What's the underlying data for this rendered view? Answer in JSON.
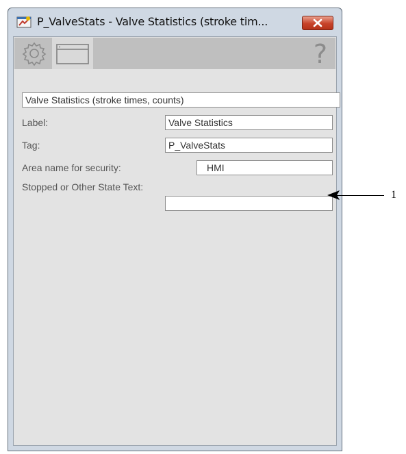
{
  "window": {
    "title": "P_ValveStats - Valve Statistics (stroke tim...",
    "close_icon": "close-icon",
    "app_icon": "faceplate-app-icon"
  },
  "toolbar": {
    "tabs": [
      {
        "icon": "gear-icon",
        "name": "config"
      },
      {
        "icon": "window-icon",
        "name": "display"
      }
    ],
    "help_label": "?"
  },
  "form": {
    "description": "Valve Statistics (stroke times, counts)",
    "label_label": "Label:",
    "label_value": "Valve Statistics",
    "tag_label": "Tag:",
    "tag_value": "P_ValveStats",
    "area_label": "Area name for security:",
    "area_value": "HMI",
    "state_text_label": "Stopped or Other State Text:",
    "state_text_value": ""
  },
  "annotation": {
    "callout_number": "1"
  },
  "colors": {
    "title_bar": "#cfd8e3",
    "close_button": "#c7432a",
    "toolbar": "#bfbfbf",
    "client_bg": "#e3e3e3"
  }
}
